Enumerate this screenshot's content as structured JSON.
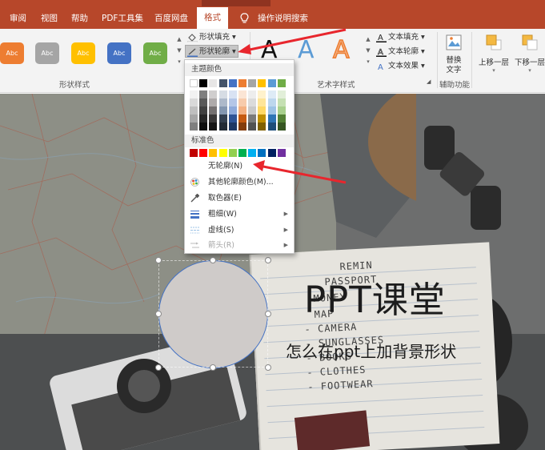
{
  "tabs": {
    "review": "审阅",
    "view": "视图",
    "help": "帮助",
    "pdf_tools": "PDF工具集",
    "baidu_disk": "百度网盘",
    "format": "格式",
    "tell_me": "操作说明搜索"
  },
  "ribbon": {
    "shape_styles": {
      "label": "形状样式",
      "buttons": [
        {
          "label": "Abc",
          "color": "#ed7d31"
        },
        {
          "label": "Abc",
          "color": "#a5a5a5"
        },
        {
          "label": "Abc",
          "color": "#ffc000"
        },
        {
          "label": "Abc",
          "color": "#4472c4"
        },
        {
          "label": "Abc",
          "color": "#70ad47"
        }
      ],
      "shape_fill": "形状填充",
      "shape_outline": "形状轮廓"
    },
    "wordart": {
      "label": "艺术字样式",
      "letters": [
        "A",
        "A",
        "A"
      ],
      "text_fill": "文本填充",
      "text_outline": "文本轮廓",
      "text_effects": "文本效果"
    },
    "accessibility": {
      "label": "辅助功能",
      "alt_text": "替换文字"
    },
    "arrange": {
      "bring_forward": "上移一层",
      "send_backward": "下移一层"
    }
  },
  "menu": {
    "theme_colors_label": "主题颜色",
    "standard_colors_label": "标准色",
    "theme_columns": [
      [
        "#ffffff",
        "#f2f2f2",
        "#d9d9d9",
        "#bfbfbf",
        "#a6a6a6",
        "#7f7f7f"
      ],
      [
        "#000000",
        "#7f7f7f",
        "#595959",
        "#404040",
        "#262626",
        "#0d0d0d"
      ],
      [
        "#e7e6e6",
        "#d0cece",
        "#aeaaaa",
        "#757171",
        "#3a3838",
        "#171616"
      ],
      [
        "#44546a",
        "#d6dce4",
        "#adb9ca",
        "#8497b0",
        "#333f4f",
        "#222a35"
      ],
      [
        "#4472c4",
        "#d9e2f3",
        "#b4c6e7",
        "#8eaadb",
        "#2f5496",
        "#1f3864"
      ],
      [
        "#ed7d31",
        "#fbe5d5",
        "#f7cbac",
        "#f4b183",
        "#c55a11",
        "#833c0b"
      ],
      [
        "#a5a5a5",
        "#ededed",
        "#dbdbdb",
        "#c9c9c9",
        "#7b7b7b",
        "#525252"
      ],
      [
        "#ffc000",
        "#fff2cc",
        "#fee599",
        "#ffd965",
        "#bf8f00",
        "#7f6000"
      ],
      [
        "#5b9bd5",
        "#deebf6",
        "#bdd7ee",
        "#9dc3e6",
        "#2e75b5",
        "#1e4e79"
      ],
      [
        "#70ad47",
        "#e2efd9",
        "#c5e0b3",
        "#a8d08d",
        "#538135",
        "#375623"
      ]
    ],
    "standard_colors": [
      "#c00000",
      "#ff0000",
      "#ffc000",
      "#ffff00",
      "#92d050",
      "#00b050",
      "#00b0f0",
      "#0070c0",
      "#002060",
      "#7030a0"
    ],
    "items": {
      "no_outline": "无轮廓(N)",
      "more_colors": "其他轮廓颜色(M)...",
      "eyedropper": "取色器(E)",
      "weight": "粗细(W)",
      "dashes": "虚线(S)",
      "arrows": "箭头(R)"
    }
  },
  "slide": {
    "title": "PPT课堂",
    "subtitle": "怎么在ppt上加背景形状",
    "notebook_text": [
      "REMIN",
      "PASSPORT",
      "MONEY",
      "MAP",
      "- CAMERA",
      "- SUNGLASSES",
      "- BOOKS",
      "- CLOTHES",
      "- FOOTWEAR"
    ]
  }
}
